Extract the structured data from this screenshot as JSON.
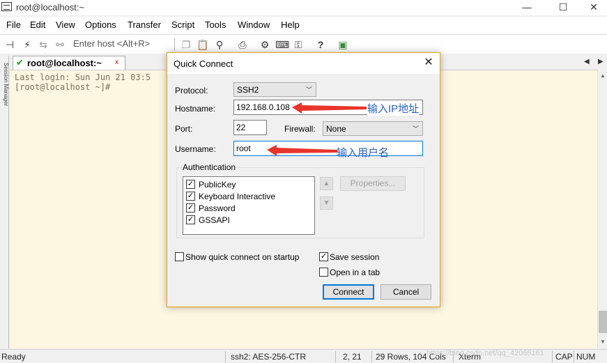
{
  "window": {
    "title": "root@localhost:~",
    "minimize": "—",
    "maximize": "☐",
    "close": "✕"
  },
  "menu": [
    "File",
    "Edit",
    "View",
    "Options",
    "Transfer",
    "Script",
    "Tools",
    "Window",
    "Help"
  ],
  "toolbar": {
    "host_placeholder": "Enter host <Alt+R>"
  },
  "side_panel": {
    "label": "Session Manager"
  },
  "tab": {
    "label": "root@localhost:~",
    "check": "✔",
    "close": "x",
    "nav_left": "◀",
    "nav_right": "▶"
  },
  "terminal": {
    "lines": [
      "Last login: Sun Jun 21 03:5",
      "[root@localhost ~]#"
    ]
  },
  "dialog": {
    "title": "Quick Connect",
    "close": "✕",
    "protocol_label": "Protocol:",
    "protocol_value": "SSH2",
    "hostname_label": "Hostname:",
    "hostname_value": "192.168.0.108",
    "port_label": "Port:",
    "port_value": "22",
    "firewall_label": "Firewall:",
    "firewall_value": "None",
    "username_label": "Username:",
    "username_value": "root",
    "auth_title": "Authentication",
    "auth_items": [
      {
        "label": "PublicKey",
        "checked": true
      },
      {
        "label": "Keyboard Interactive",
        "checked": true
      },
      {
        "label": "Password",
        "checked": true
      },
      {
        "label": "GSSAPI",
        "checked": true
      }
    ],
    "properties_label": "Properties...",
    "show_on_startup_label": "Show quick connect on startup",
    "show_on_startup_checked": false,
    "save_session_label": "Save session",
    "save_session_checked": true,
    "open_in_tab_label": "Open in a tab",
    "open_in_tab_checked": false,
    "connect_label": "Connect",
    "cancel_label": "Cancel"
  },
  "annotations": {
    "ip_note": "输入IP地址",
    "user_note": "输入用户名",
    "arrow_color": "#e8342a"
  },
  "status": {
    "ready": "Ready",
    "cipher": "ssh2: AES-256-CTR",
    "cursor": "2,  21",
    "size": "29 Rows, 104 Cols",
    "term": "Xterm",
    "cap": "CAP",
    "num": "NUM",
    "watermark": "https://blog.csdn.net/qq_42065161"
  }
}
